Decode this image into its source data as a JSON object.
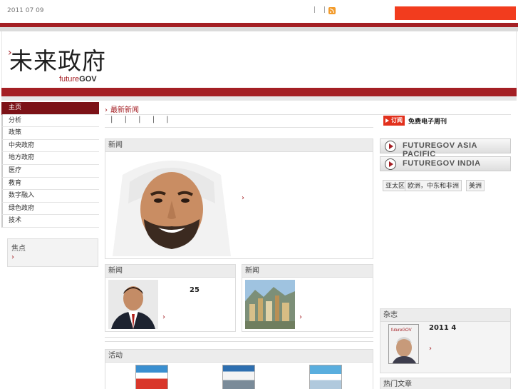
{
  "topbar": {
    "date": "2011 07 09",
    "links": [
      "|",
      "|"
    ]
  },
  "logo": {
    "cn_main": "未来",
    "cn_rest": "政府",
    "en_prefix": "future",
    "en_bold": "GOV"
  },
  "nav": {
    "items": [
      "主页",
      "分析",
      "政策",
      "中央政府",
      "地方政府",
      "医疗",
      "教育",
      "数字融入",
      "绿色政府",
      "技术"
    ],
    "active_index": 0
  },
  "focus": {
    "title": "焦点",
    "arrow": "›"
  },
  "center": {
    "latest_label": "最新新闻",
    "pipes": [
      "|",
      "|",
      "|",
      "|",
      "|"
    ],
    "main_news": {
      "title": "新闻",
      "arrow": "›"
    },
    "news_2": {
      "title": "新闻",
      "number": "25",
      "arrow": "›"
    },
    "news_3": {
      "title": "新闻",
      "arrow": "›"
    },
    "events": {
      "title": "活动"
    }
  },
  "right": {
    "subscribe_badge": "订阅",
    "subscribe_text": "免费电子周刊",
    "fg_buttons": [
      "FUTUREGOV ASIA PACIFIC",
      "FUTUREGOV INDIA"
    ],
    "regions": [
      "亚太区",
      "欧洲，中东和非洲",
      "美洲"
    ],
    "magazine": {
      "title": "杂志",
      "issue": "2011  4",
      "arrow": "›",
      "cover_title": "futureGOV"
    },
    "hot_title": "热门文章"
  },
  "colors": {
    "brand_red": "#a41f24",
    "search_orange": "#f23c1e",
    "nav_active": "#7c1217"
  }
}
